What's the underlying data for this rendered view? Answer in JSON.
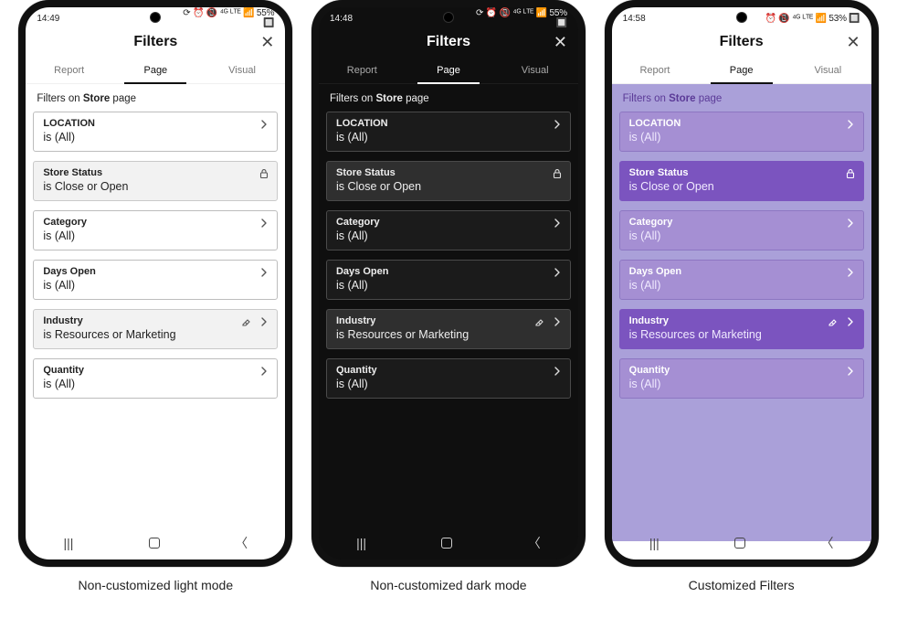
{
  "captions": {
    "light": "Non-customized light mode",
    "dark": "Non-customized dark mode",
    "custom": "Customized Filters"
  },
  "common": {
    "title": "Filters",
    "tabs": {
      "report": "Report",
      "page": "Page",
      "visual": "Visual",
      "active": "page"
    },
    "subhead_prefix": "Filters on ",
    "subhead_bold": "Store",
    "subhead_suffix": " page",
    "nav": {
      "recents": "|||",
      "home": "◯",
      "back": "〈"
    }
  },
  "filters": [
    {
      "title": "LOCATION",
      "value": "is (All)",
      "applied": false,
      "locked": false,
      "eraser": false
    },
    {
      "title": "Store Status",
      "value": "is Close or Open",
      "applied": true,
      "locked": true,
      "eraser": false
    },
    {
      "title": "Category",
      "value": "is (All)",
      "applied": false,
      "locked": false,
      "eraser": false
    },
    {
      "title": "Days Open",
      "value": "is (All)",
      "applied": false,
      "locked": false,
      "eraser": false
    },
    {
      "title": "Industry",
      "value": "is Resources or Marketing",
      "applied": true,
      "locked": false,
      "eraser": true
    },
    {
      "title": "Quantity",
      "value": "is (All)",
      "applied": false,
      "locked": false,
      "eraser": false
    }
  ],
  "status": {
    "light": {
      "time": "14:49",
      "right": "⟳ ⏰ 📵 ⁴ᴳ ᴸᵀᴱ 📶 55% 🔲"
    },
    "dark": {
      "time": "14:48",
      "right": "⟳ ⏰ 📵 ⁴ᴳ ᴸᵀᴱ 📶 55% 🔲"
    },
    "custom": {
      "time": "14:58",
      "right": "⏰ 📵 ⁴ᴳ ᴸᵀᴱ 📶 53% 🔲"
    }
  },
  "colors": {
    "custom_bg": "#aaa0d9",
    "custom_card": "#a58fd3",
    "custom_card_applied": "#7b54bf",
    "custom_subhead": "#5b3a97"
  }
}
